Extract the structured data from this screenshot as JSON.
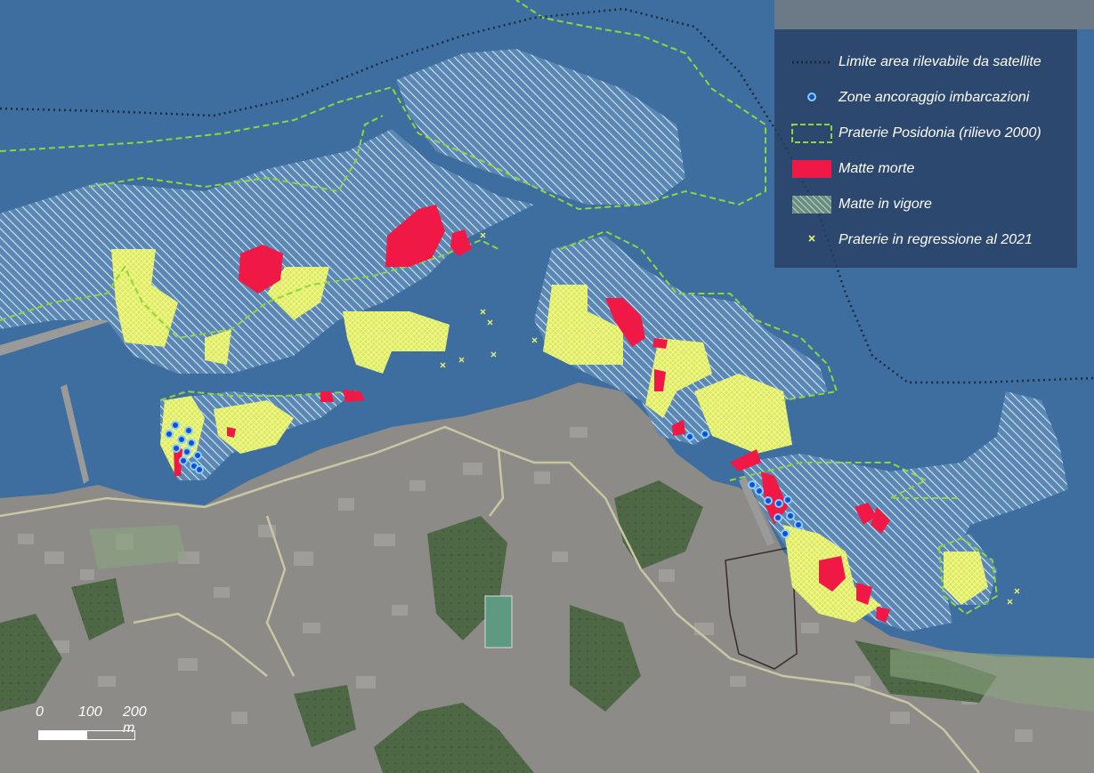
{
  "legend": {
    "items": [
      {
        "label": "Limite area rilevabile da satellite",
        "symbol": "dotted-line-symbol"
      },
      {
        "label": "Zone ancoraggio imbarcazioni",
        "symbol": "anchor-point-symbol"
      },
      {
        "label": "Praterie Posidonia (rilievo 2000)",
        "symbol": "dashed-box-symbol"
      },
      {
        "label": "Matte morte",
        "symbol": "red-fill-symbol"
      },
      {
        "label": "Matte in vigore",
        "symbol": "hatch-fill-symbol"
      },
      {
        "label": "Praterie in regressione al 2021",
        "symbol": "yellow-cross-symbol"
      }
    ]
  },
  "scale": {
    "labels": [
      "0",
      "100",
      "200 m"
    ]
  },
  "colors": {
    "sea": "#3e6e9f",
    "land": "#8c8b87",
    "vegetation": "#4e6845",
    "posidonia_boundary": "#8fd63c",
    "dead_matte": "#f01844",
    "regression": "#e6f26a",
    "anchoring": "#1c4bd1",
    "satellite_limit": "#1c2a3f"
  }
}
